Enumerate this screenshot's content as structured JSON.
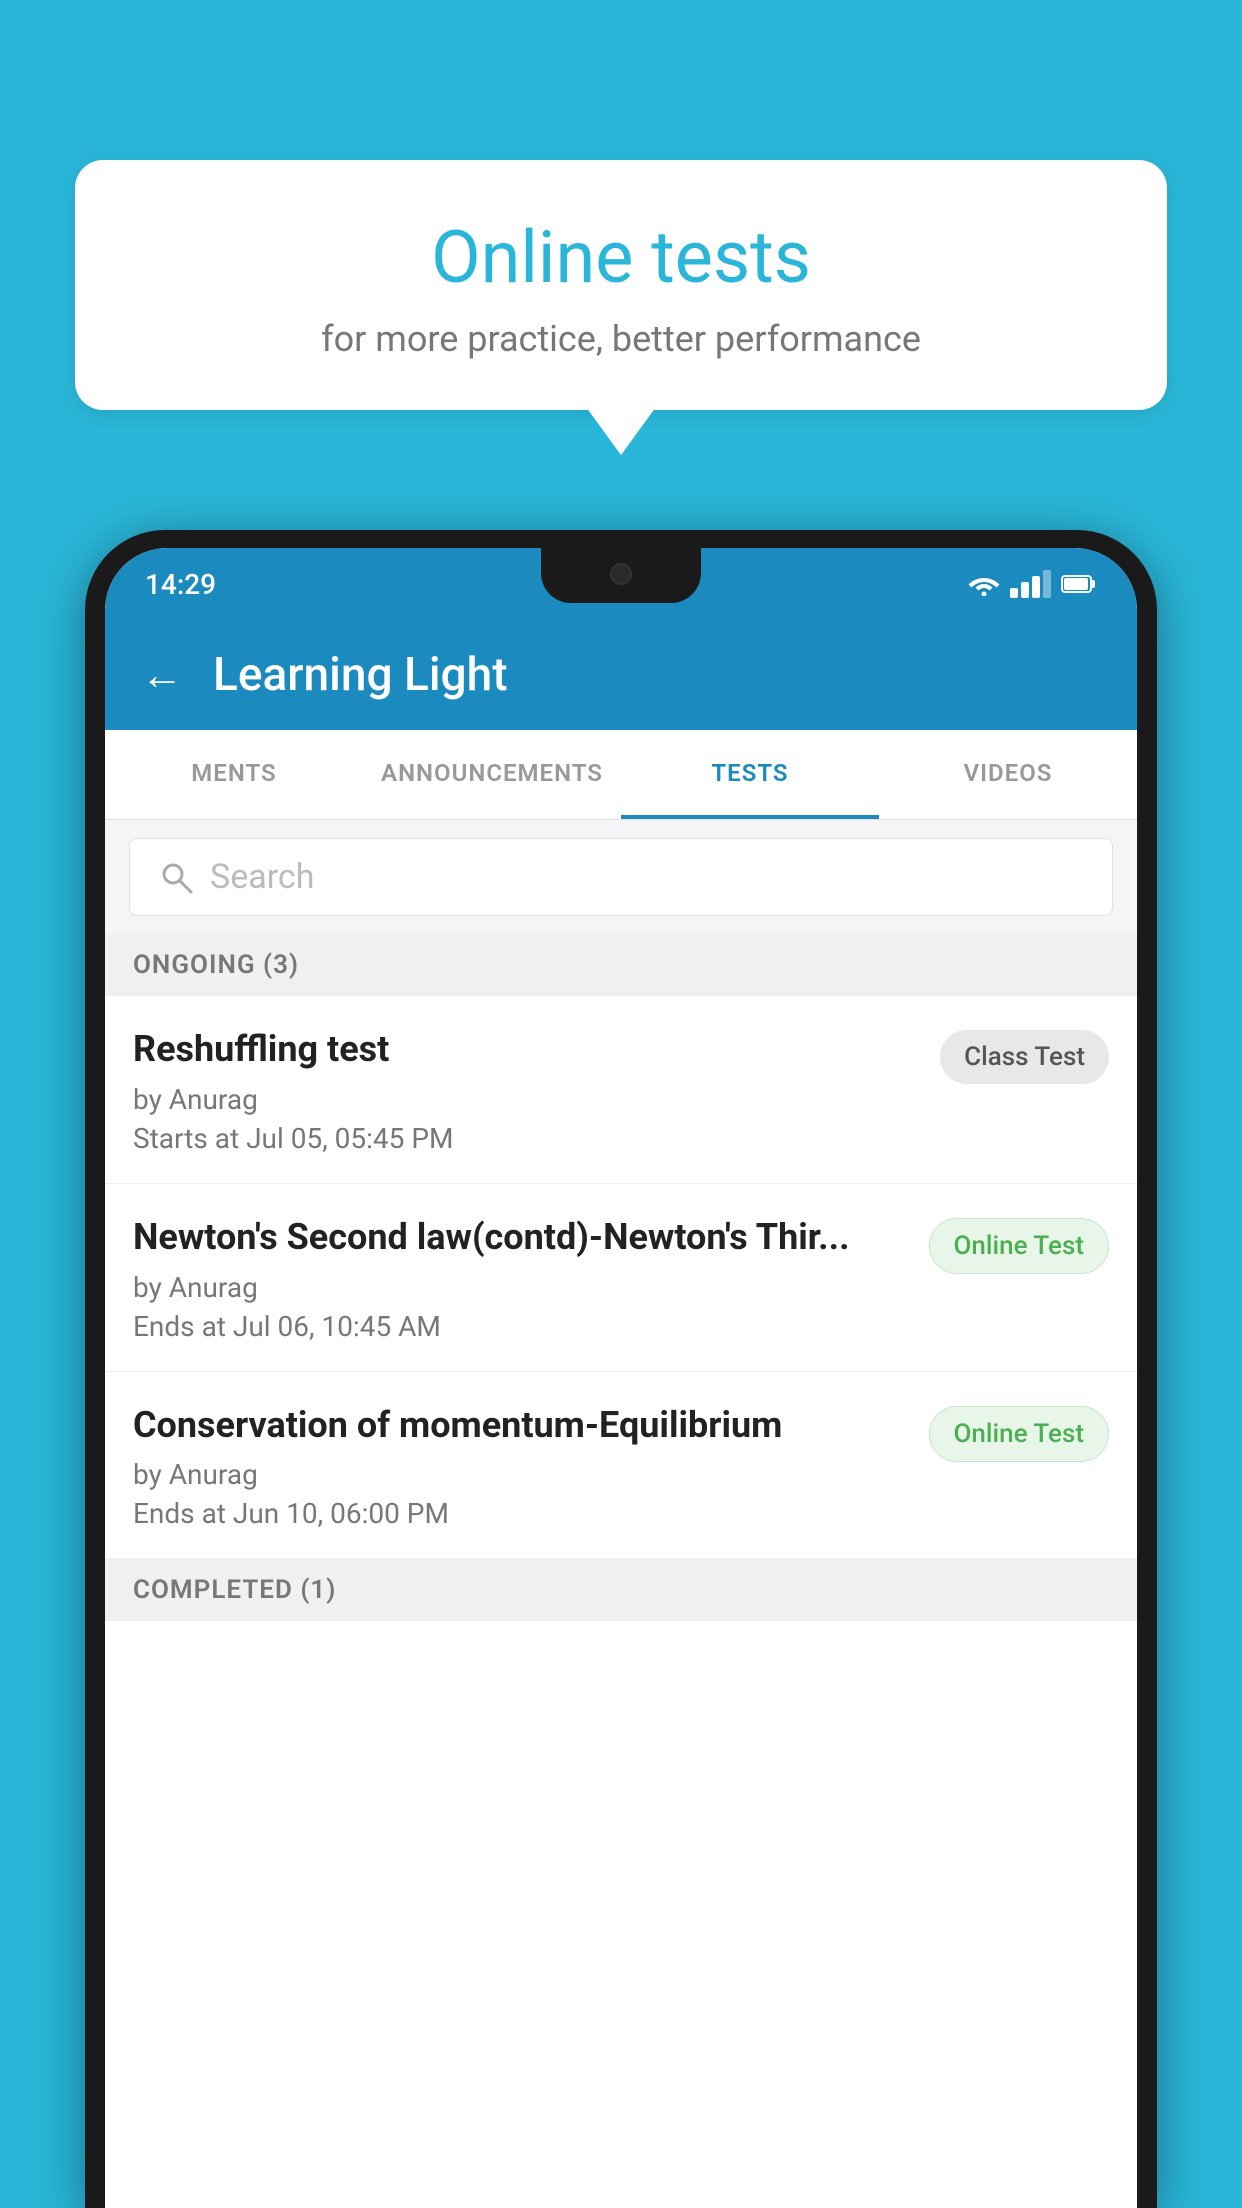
{
  "background_color": "#29b6d8",
  "bubble": {
    "title": "Online tests",
    "subtitle": "for more practice, better performance"
  },
  "status_bar": {
    "time": "14:29",
    "icons": [
      "wifi",
      "signal",
      "battery"
    ]
  },
  "app_bar": {
    "title": "Learning Light",
    "back_label": "←"
  },
  "tabs": [
    {
      "label": "MENTS",
      "active": false
    },
    {
      "label": "ANNOUNCEMENTS",
      "active": false
    },
    {
      "label": "TESTS",
      "active": true
    },
    {
      "label": "VIDEOS",
      "active": false
    }
  ],
  "search": {
    "placeholder": "Search"
  },
  "ongoing_section": {
    "label": "ONGOING (3)"
  },
  "tests": [
    {
      "name": "Reshuffling test",
      "by": "by Anurag",
      "date": "Starts at  Jul 05, 05:45 PM",
      "badge": "Class Test",
      "badge_type": "class"
    },
    {
      "name": "Newton's Second law(contd)-Newton's Thir...",
      "by": "by Anurag",
      "date": "Ends at  Jul 06, 10:45 AM",
      "badge": "Online Test",
      "badge_type": "online"
    },
    {
      "name": "Conservation of momentum-Equilibrium",
      "by": "by Anurag",
      "date": "Ends at  Jun 10, 06:00 PM",
      "badge": "Online Test",
      "badge_type": "online"
    }
  ],
  "completed_section": {
    "label": "COMPLETED (1)"
  }
}
